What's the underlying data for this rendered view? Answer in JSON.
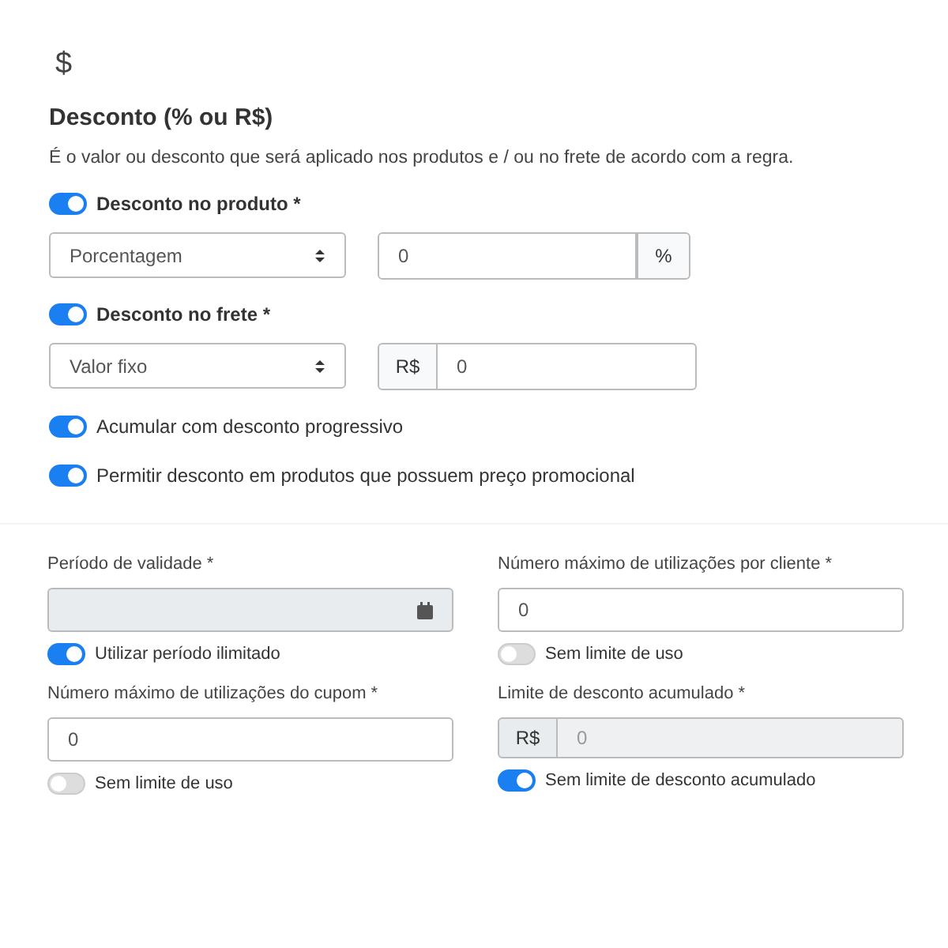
{
  "discount": {
    "icon": "$",
    "title": "Desconto (% ou R$)",
    "description": "É o valor ou desconto que será aplicado nos produtos e / ou no frete de acordo com a regra.",
    "blocks": [
      {
        "toggle": {
          "label": "Desconto no produto *",
          "on": true
        },
        "select": {
          "value": "Porcentagem"
        },
        "input": {
          "value": "0",
          "addon": "%",
          "kind": "suffix"
        }
      },
      {
        "toggle": {
          "label": "Desconto no frete *",
          "on": true
        },
        "select": {
          "value": "Valor fixo"
        },
        "input": {
          "value": "0",
          "addon": "R$",
          "kind": "prefix"
        }
      }
    ],
    "options": [
      {
        "label": "Acumular com desconto progressivo",
        "on": true
      },
      {
        "label": "Permitir desconto em produtos que possuem preço promocional",
        "on": true
      }
    ]
  },
  "limits": [
    {
      "kind": "date",
      "label": "Período de validade *",
      "disabled": true,
      "toggle": {
        "label": "Utilizar período ilimitado",
        "on": true
      }
    },
    {
      "kind": "number",
      "label": "Número máximo de utilizações por cliente *",
      "value": "0",
      "disabled": false,
      "toggle": {
        "label": "Sem limite de uso",
        "on": false
      }
    },
    {
      "kind": "number",
      "label": "Número máximo de utilizações do cupom *",
      "value": "0",
      "disabled": false,
      "toggle": {
        "label": "Sem limite de uso",
        "on": false
      }
    },
    {
      "kind": "currency",
      "label": "Limite de desconto acumulado *",
      "addon": "R$",
      "value": "0",
      "disabled": true,
      "toggle": {
        "label": "Sem limite de desconto acumulado",
        "on": true
      }
    }
  ]
}
